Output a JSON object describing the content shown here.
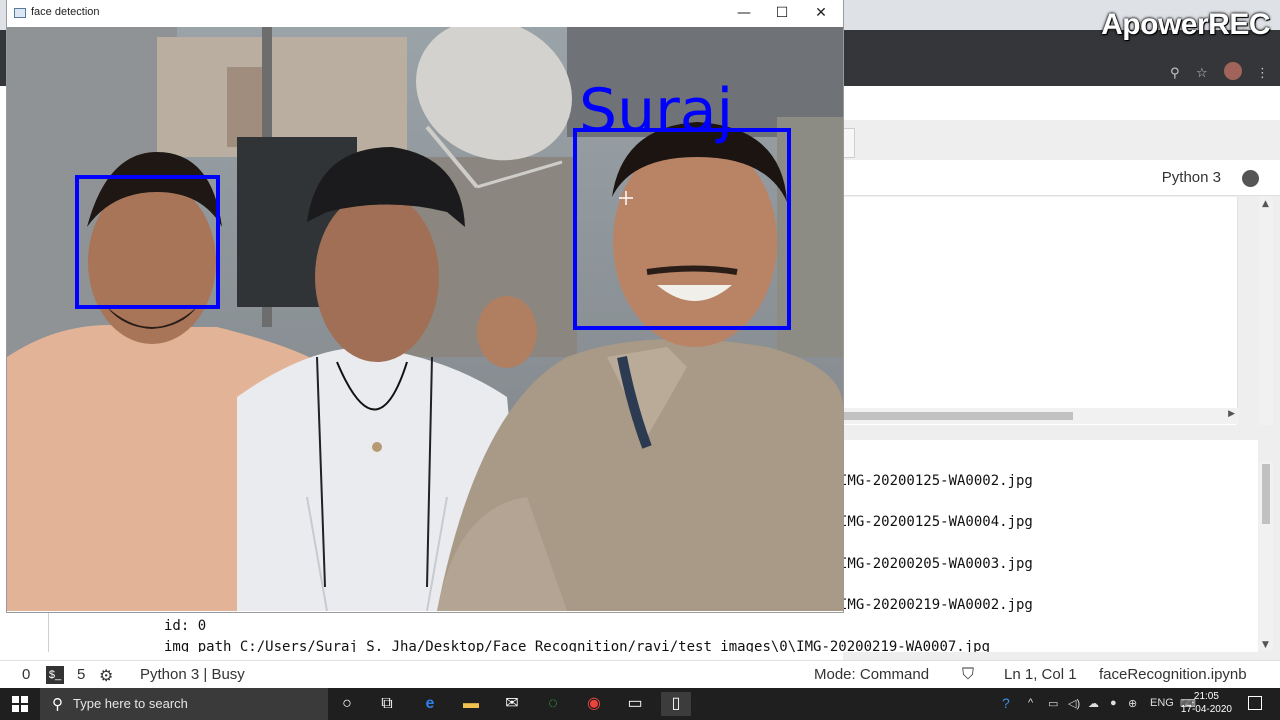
{
  "watermark": {
    "text": "ApowerREC"
  },
  "face_window": {
    "title": "face detection",
    "controls": {
      "minimize": "—",
      "maximize": "☐",
      "close": "✕"
    },
    "label_text": "Suraj",
    "box_color": "#0000ff"
  },
  "notebook": {
    "kernel_name": "Python 3",
    "output_lines": [
      "IMG-20200125-WA0002.jpg",
      "IMG-20200125-WA0004.jpg",
      "IMG-20200205-WA0003.jpg",
      "IMG-20200219-WA0002.jpg"
    ],
    "id_line": "id: 0",
    "path_line": "img_path C:/Users/Suraj S. Jha/Desktop/Face Recognition/ravi/test images\\0\\IMG-20200219-WA0007.jpg"
  },
  "statusbar": {
    "zero": "0",
    "five": "5",
    "kernel_status": "Python 3 | Busy",
    "mode": "Mode: Command",
    "position": "Ln 1, Col 1",
    "filename": "faceRecognition.ipynb"
  },
  "taskbar": {
    "search_placeholder": "Type here to search",
    "language": "ENG",
    "time": "21:05",
    "date": "17-04-2020"
  }
}
